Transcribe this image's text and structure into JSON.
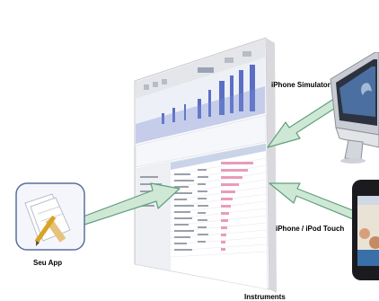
{
  "labels": {
    "app": "Seu App",
    "simulator": "iPhone Simulator",
    "device": "iPhone / iPod Touch",
    "instruments": "Instruments"
  },
  "colors": {
    "arrow_fill": "#cfe8d6",
    "arrow_stroke": "#5f9f7c",
    "window_bg": "#f3f4f6",
    "track_blue": "#5a6fc4",
    "bar_pink": "#e99bbb"
  },
  "icons": {
    "app": "xcode-app-icon",
    "simulator": "imac-icon",
    "device": "iphone-icon"
  }
}
